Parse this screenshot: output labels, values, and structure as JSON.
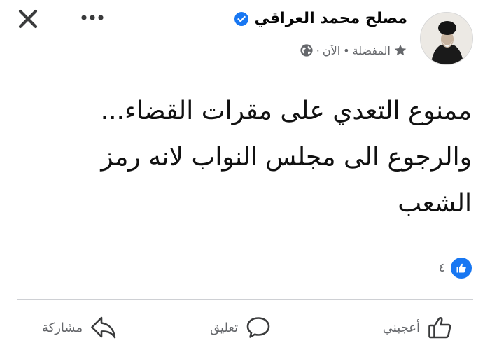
{
  "header": {
    "author_name": "مصلح محمد العراقي",
    "meta_favorites": "المفضلة",
    "meta_separator": "•",
    "meta_time": "الآن",
    "meta_dot": "·"
  },
  "post": {
    "lines": [
      "ممنوع التعدي على مقرات القضاء...",
      "والرجوع الى مجلس النواب لانه رمز",
      "الشعب"
    ]
  },
  "reactions": {
    "count": "٤"
  },
  "actions": {
    "like_label": "أعجبني",
    "comment_label": "تعليق",
    "share_label": "مشاركة"
  },
  "colors": {
    "brand_blue": "#1877f2",
    "secondary_text": "#65676b",
    "divider": "#ced0d4"
  },
  "icons": {
    "close": "close-icon",
    "more": "more-horizontal-icon",
    "verified": "verified-badge-icon",
    "favorites": "star-icon",
    "audience": "globe-icon",
    "reaction": "like-reaction-icon",
    "like": "thumbs-up-icon",
    "comment": "comment-bubble-icon",
    "share": "share-arrow-icon"
  }
}
